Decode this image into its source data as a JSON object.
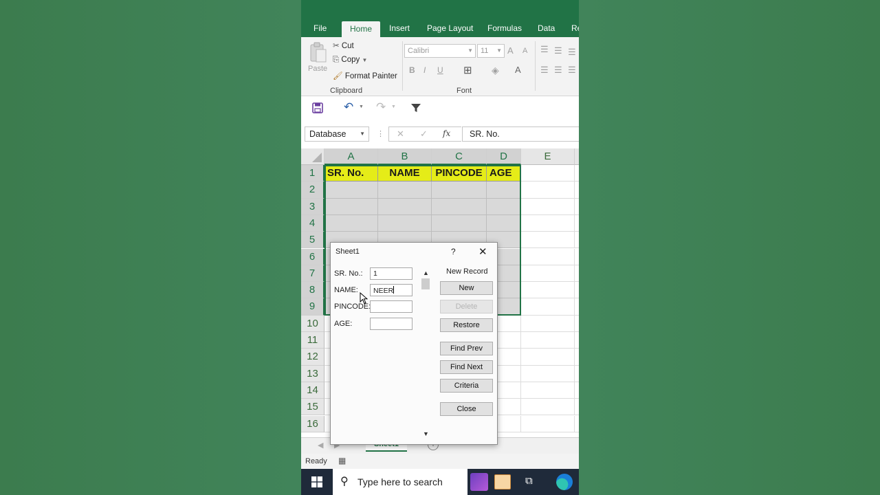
{
  "ribbon_tabs": [
    "File",
    "Home",
    "Insert",
    "Page Layout",
    "Formulas",
    "Data",
    "Re"
  ],
  "clipboard": {
    "paste": "Paste",
    "cut": "Cut",
    "copy": "Copy",
    "format_painter": "Format Painter",
    "group_label": "Clipboard"
  },
  "font": {
    "name": "Calibri",
    "size": "11",
    "bold": "B",
    "italic": "I",
    "underline": "U",
    "grow": "A",
    "shrink": "A",
    "color": "A",
    "group_label": "Font"
  },
  "formula_bar": {
    "name_box": "Database",
    "fx": "fx",
    "content": "SR. No."
  },
  "columns": [
    "A",
    "B",
    "C",
    "D",
    "E"
  ],
  "rows": [
    "1",
    "2",
    "3",
    "4",
    "5",
    "6",
    "7",
    "8",
    "9",
    "10",
    "11",
    "12",
    "13",
    "14",
    "15",
    "16"
  ],
  "headers": [
    "SR. No.",
    "NAME",
    "PINCODE",
    "AGE"
  ],
  "sheet_tab": "Sheet1",
  "status": "Ready",
  "taskbar": {
    "search_placeholder": "Type here to search"
  },
  "dialog": {
    "title": "Sheet1",
    "help": "?",
    "fields": [
      {
        "label": "SR. No.:",
        "value": "1"
      },
      {
        "label": "NAME:",
        "value": "NEER"
      },
      {
        "label": "PINCODE:",
        "value": ""
      },
      {
        "label": "AGE:",
        "value": ""
      }
    ],
    "record_status": "New Record",
    "buttons": {
      "new": "New",
      "delete": "Delete",
      "restore": "Restore",
      "find_prev": "Find Prev",
      "find_next": "Find Next",
      "criteria": "Criteria",
      "close": "Close"
    }
  },
  "colors": {
    "excel_green": "#217346",
    "header_fill": "#e5ec18",
    "background": "#3f7f52"
  }
}
